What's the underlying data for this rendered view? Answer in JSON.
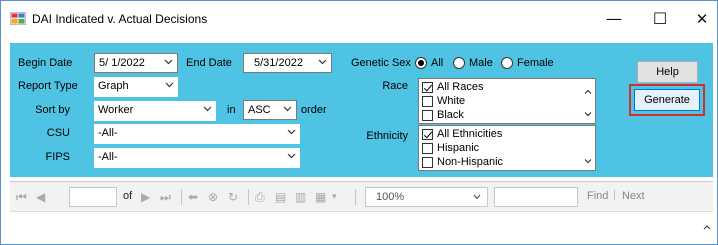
{
  "window": {
    "title": "DAI Indicated v. Actual Decisions"
  },
  "form": {
    "begin_date": {
      "label": "Begin Date",
      "value": "5/ 1/2022"
    },
    "end_date": {
      "label": "End Date",
      "value": "5/31/2022"
    },
    "report_type": {
      "label": "Report Type",
      "value": "Graph"
    },
    "sort_by": {
      "label": "Sort by",
      "value": "Worker",
      "in_label": "in",
      "order_value": "ASC",
      "order_label": "order"
    },
    "csu": {
      "label": "CSU",
      "value": "-All-"
    },
    "fips": {
      "label": "FIPS",
      "value": "-All-"
    },
    "genetic_sex": {
      "label": "Genetic Sex",
      "options": [
        "All",
        "Male",
        "Female"
      ],
      "selected": "All"
    },
    "race": {
      "label": "Race",
      "items": [
        {
          "label": "All Races",
          "checked": true
        },
        {
          "label": "White",
          "checked": false
        },
        {
          "label": "Black",
          "checked": false
        }
      ]
    },
    "ethnicity": {
      "label": "Ethnicity",
      "items": [
        {
          "label": "All Ethnicities",
          "checked": true
        },
        {
          "label": "Hispanic",
          "checked": false
        },
        {
          "label": "Non-Hispanic",
          "checked": false
        }
      ]
    },
    "help_label": "Help",
    "generate_label": "Generate"
  },
  "report_toolbar": {
    "of_label": "of",
    "zoom_value": "100%",
    "find_label": "Find",
    "separator": "|",
    "next_label": "Next"
  },
  "colors": {
    "panel": "#4fc3e3",
    "highlight": "#d0312d",
    "window_border": "#5b8fd0"
  }
}
